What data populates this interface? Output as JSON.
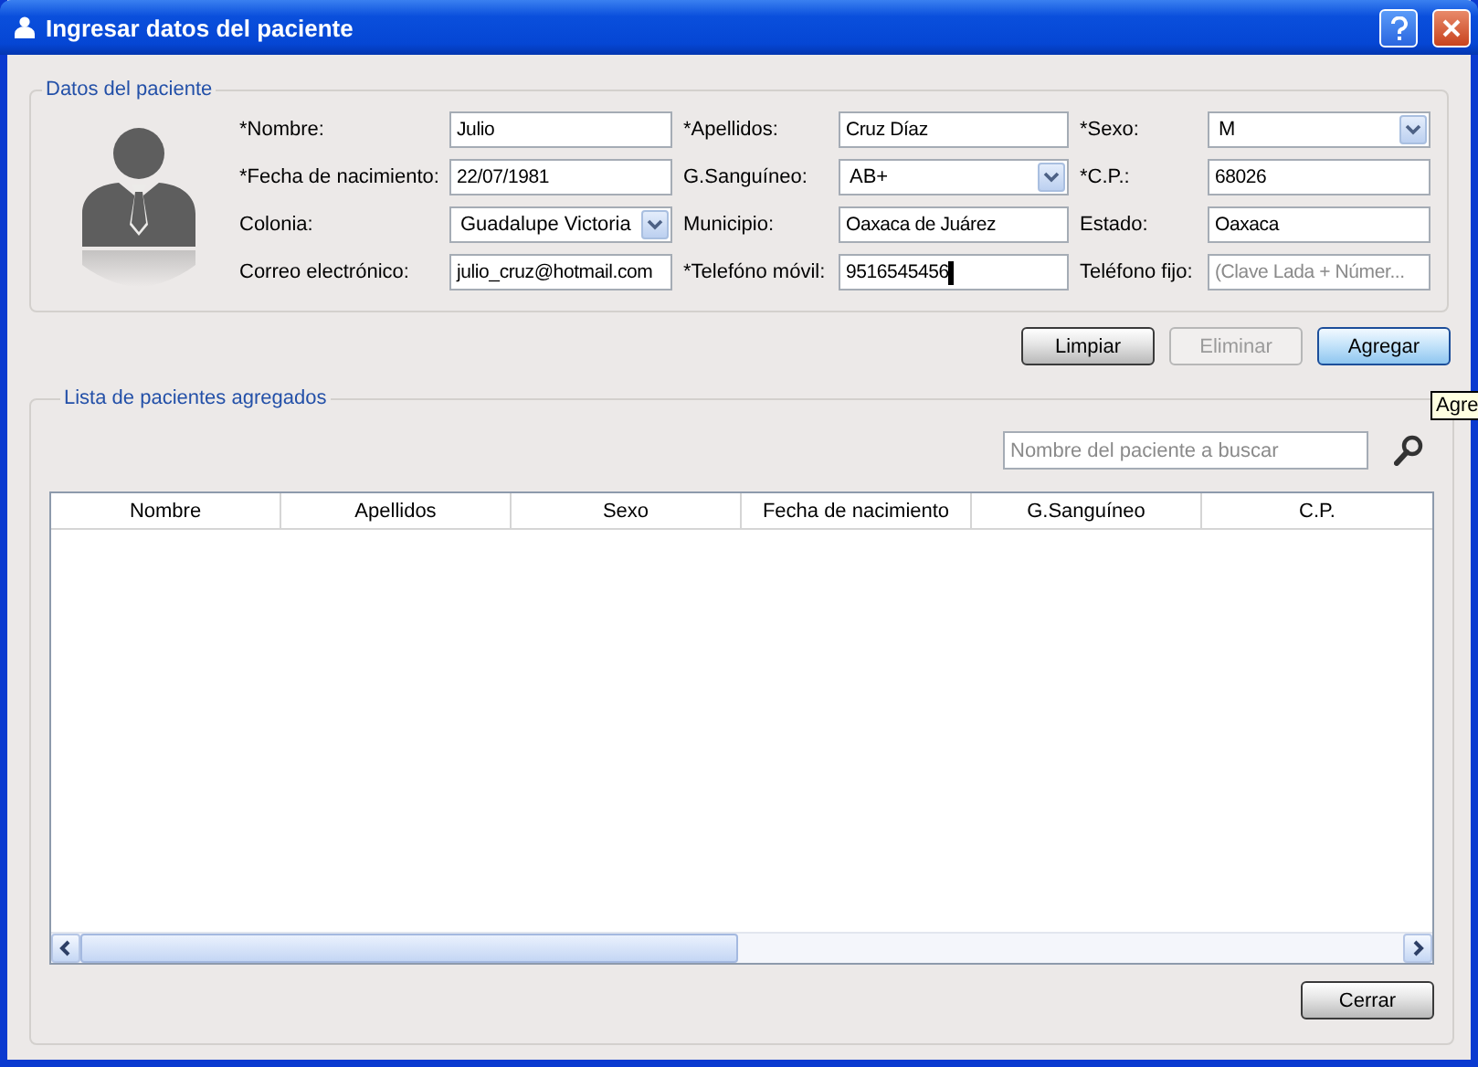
{
  "window": {
    "title": "Ingresar datos del paciente"
  },
  "patient_section": {
    "title": "Datos del paciente",
    "fields": [
      {
        "label": "*Nombre:",
        "kind": "text",
        "value": "Julio"
      },
      {
        "label": "*Apellidos:",
        "kind": "text",
        "value": "Cruz Díaz"
      },
      {
        "label": "*Sexo:",
        "kind": "select",
        "value": "M"
      },
      {
        "label": "*Fecha de nacimiento:",
        "kind": "text",
        "value": "22/07/1981"
      },
      {
        "label": "G.Sanguíneo:",
        "kind": "select",
        "value": "AB+"
      },
      {
        "label": "*C.P.:",
        "kind": "text",
        "value": "68026"
      },
      {
        "label": "Colonia:",
        "kind": "select",
        "value": "Guadalupe Victoria"
      },
      {
        "label": "Municipio:",
        "kind": "text",
        "value": "Oaxaca de Juárez"
      },
      {
        "label": "Estado:",
        "kind": "text",
        "value": "Oaxaca"
      },
      {
        "label": "Correo electrónico:",
        "kind": "text",
        "value": "julio_cruz@hotmail.com"
      },
      {
        "label": "*Telefóno móvil:",
        "kind": "text",
        "value": "9516545456",
        "focused": true
      },
      {
        "label": "Teléfono fijo:",
        "kind": "text",
        "placeholder": "(Clave Lada + Númer..."
      }
    ]
  },
  "actions": [
    {
      "label": "Limpiar",
      "disabled": false,
      "default": false
    },
    {
      "label": "Eliminar",
      "disabled": true,
      "default": false
    },
    {
      "label": "Agregar",
      "disabled": false,
      "default": true
    }
  ],
  "tooltip": "Agre",
  "list_section": {
    "title": "Lista de pacientes agregados",
    "search": {
      "placeholder": "Nombre del paciente a buscar"
    },
    "table": {
      "columns": [
        "Nombre",
        "Apellidos",
        "Sexo",
        "Fecha de nacimiento",
        "G.Sanguíneo",
        "C.P."
      ]
    }
  },
  "close_button": "Cerrar"
}
